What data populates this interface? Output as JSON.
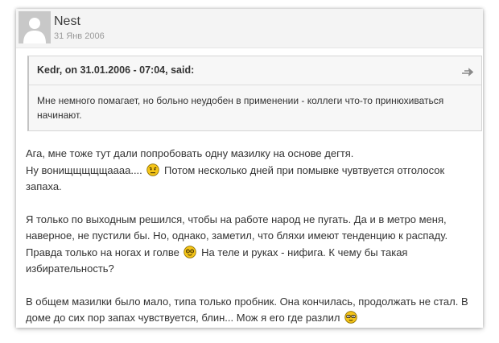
{
  "post": {
    "author": "Nest",
    "date": "31 Янв 2006"
  },
  "quote": {
    "cite": "Kedr, on 31.01.2006 - 07:04, said:",
    "text": "Мне немного помагает, но больно неудобен в применении - коллеги что-то принюхиваться начинают.",
    "jump_icon": "quote-jump-arrow-icon"
  },
  "body": {
    "p1": {
      "line1": "Ага, мне тоже тут дали попробовать одну мазилку на основе дегтя.",
      "line2a": "Ну вонищщщщщаааа....",
      "line2b": "Потом несколько дней при помывке чувтвуется отголосок запаха."
    },
    "p2": {
      "a": "Я только по выходным решился, чтобы на работе народ не пугать. Да и в метро меня, наверное, не пустили бы. Но, однако, заметил, что бляхи имеют тенденцию к распаду. Правда только на ногах и голве",
      "b": "На теле и руках - нифига. К чему бы такая избирательность?"
    },
    "p3": {
      "a": "В общем мазилки было мало, типа только пробник. Она кончилась, продолжать не стал. В доме до сих пор запах чувствуется, блин... Мож я его где разлил"
    }
  },
  "colors": {
    "header_bg": "#f4f4f4",
    "quote_bg": "#f7f7f7",
    "text": "#333333",
    "muted": "#9a9a9a",
    "emoticon": "#f5c518"
  }
}
